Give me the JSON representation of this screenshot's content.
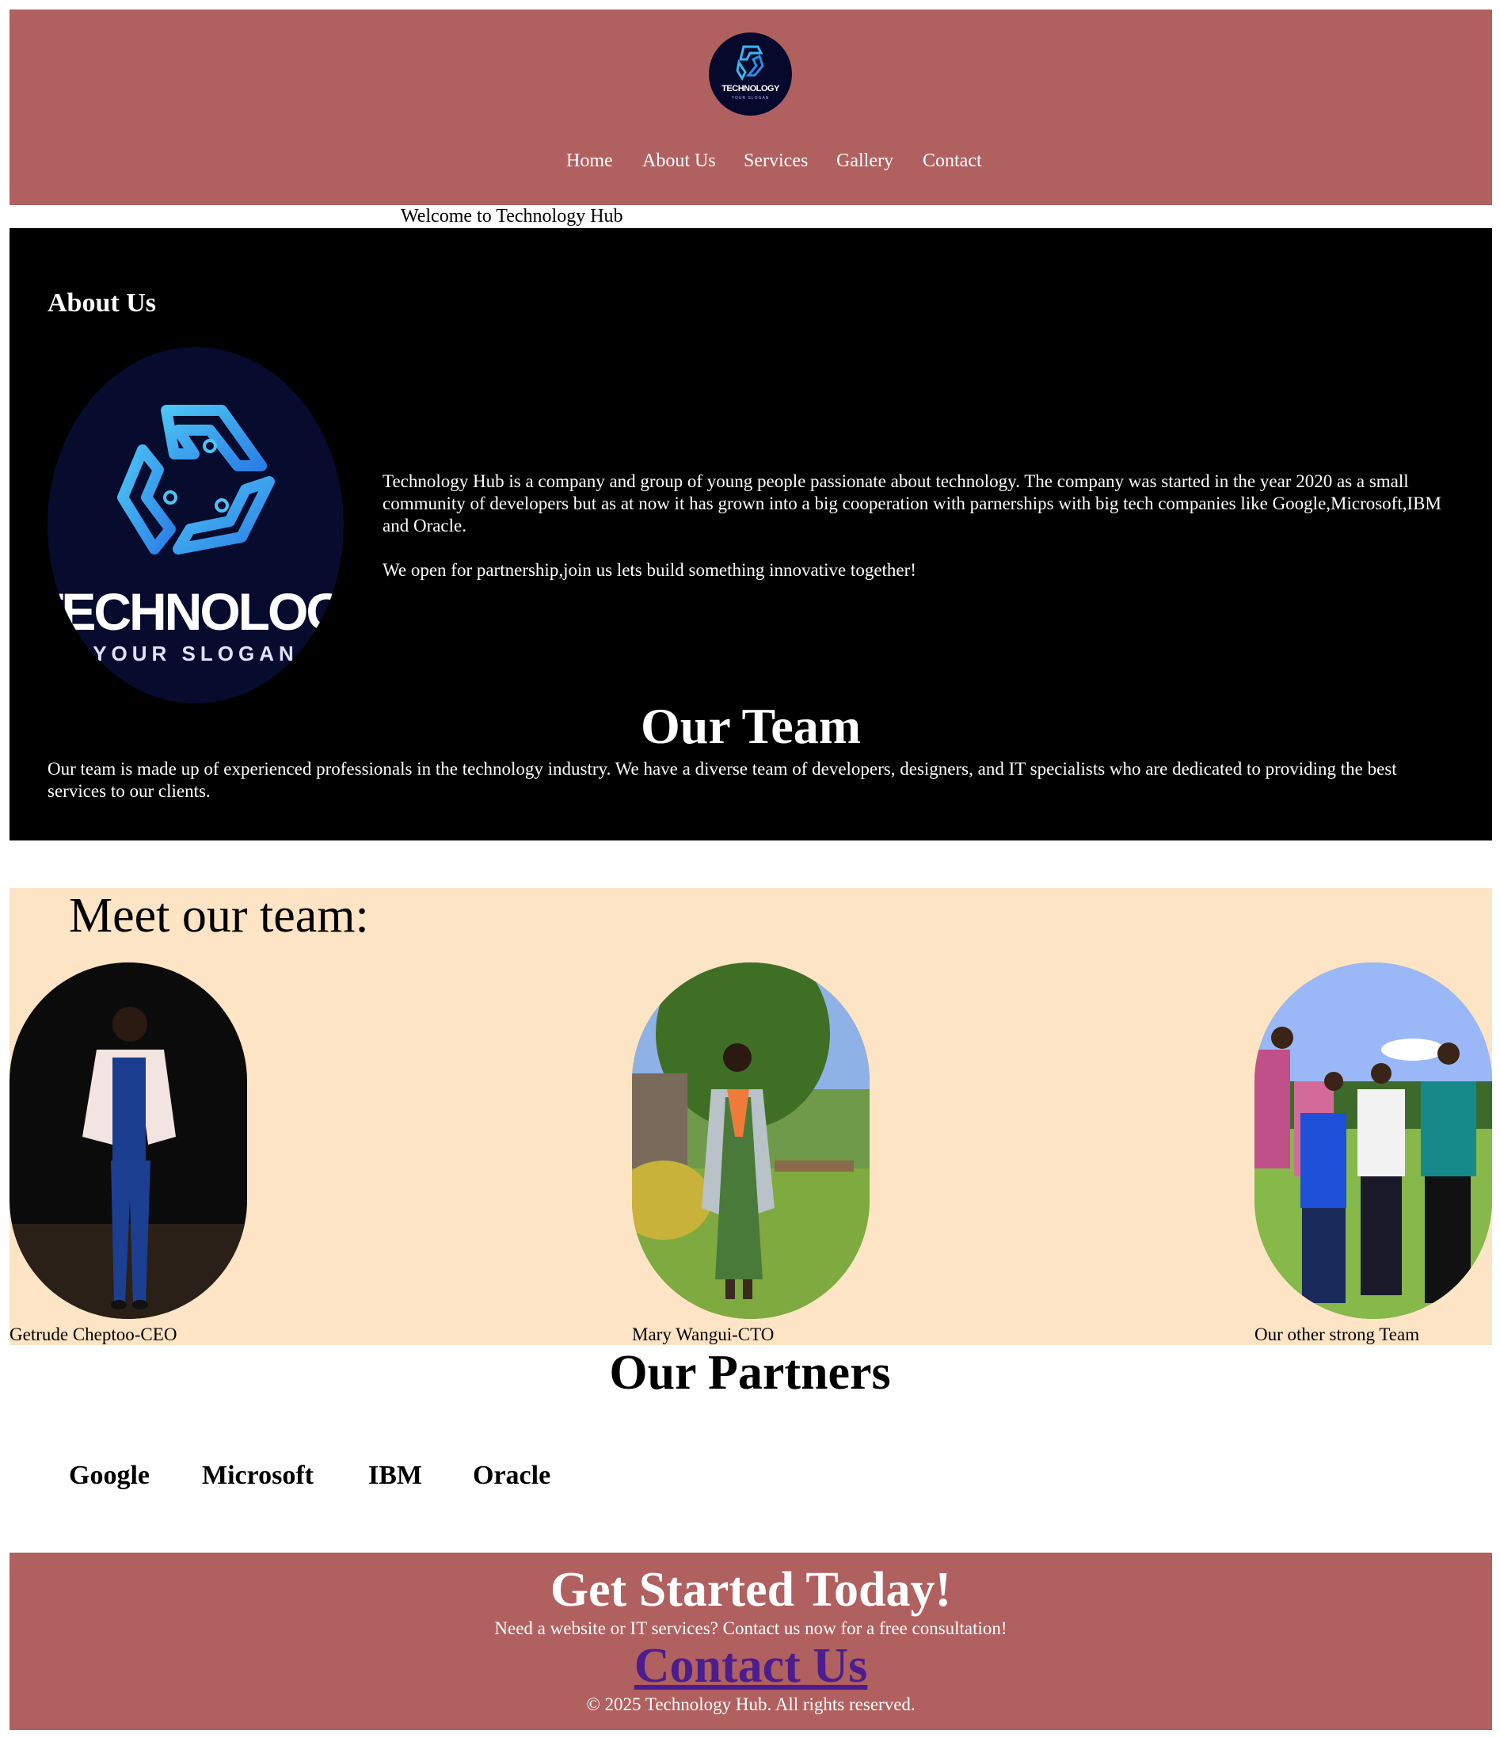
{
  "header": {
    "logo_brand": "TECHNOLOGY",
    "logo_slogan": "YOUR SLOGAN",
    "nav": [
      "Home",
      "About Us",
      "Services",
      "Gallery",
      "Contact"
    ]
  },
  "welcome": "Welcome to Technology Hub",
  "about": {
    "title": "About Us",
    "logo_brand": "TECHNOLOGY",
    "logo_slogan": "YOUR SLOGAN",
    "paragraph1": "Technology Hub is a company and group of young people passionate about technology. The company was started in the year 2020 as a small community of developers but as at now it has grown into a big cooperation with parnerships with big tech companies like Google,Microsoft,IBM and Oracle.",
    "paragraph2": "We open for partnership,join us lets build something innovative together!"
  },
  "team": {
    "title": "Our Team",
    "text": "Our team is made up of experienced professionals in the technology industry. We have a diverse team of developers, designers, and IT specialists who are dedicated to providing the best services to our clients."
  },
  "meet": {
    "title": "Meet our team:",
    "members": [
      {
        "caption": "Getrude Cheptoo-CEO"
      },
      {
        "caption": "Mary Wangui-CTO"
      },
      {
        "caption": "Our other strong Team"
      }
    ]
  },
  "partners": {
    "title": "Our Partners",
    "items": [
      "Google",
      "Microsoft",
      "IBM",
      "Oracle"
    ]
  },
  "cta": {
    "title": "Get Started Today!",
    "text": "Need a website or IT services? Contact us now for a free consultation!",
    "link": "Contact Us",
    "copyright": "© 2025 Technology Hub. All rights reserved."
  },
  "colors": {
    "header_bg": "#b16060",
    "about_bg": "#000000",
    "meet_bg": "#fde4c5",
    "link": "#4b1d8f"
  }
}
